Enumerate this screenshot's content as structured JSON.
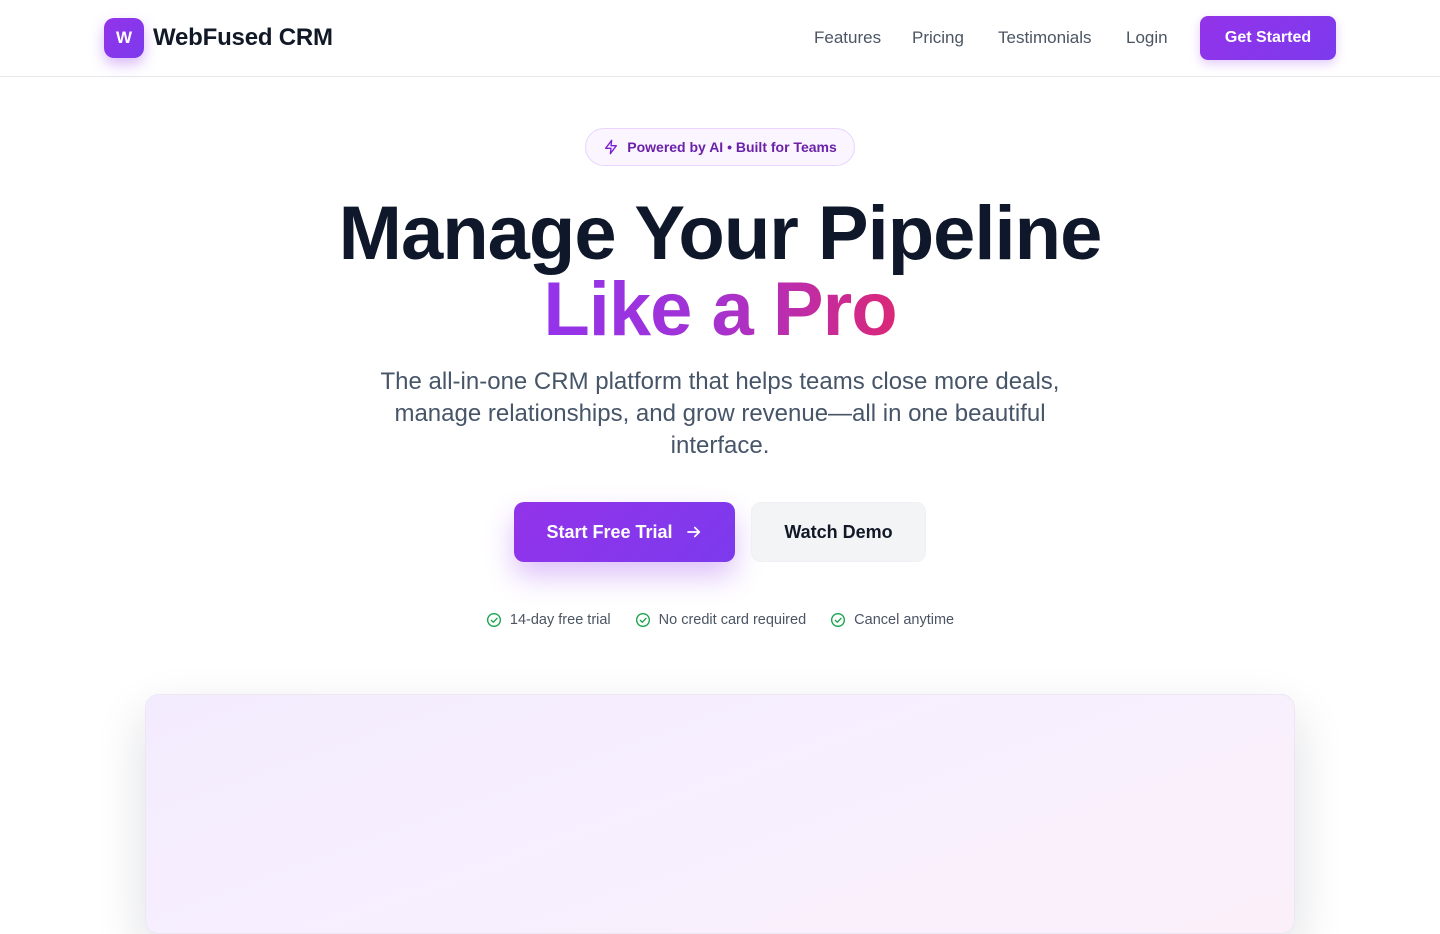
{
  "header": {
    "logo_letter": "W",
    "brand_name": "WebFused CRM",
    "nav": [
      "Features",
      "Pricing",
      "Testimonials",
      "Login"
    ],
    "cta_label": "Get Started"
  },
  "hero": {
    "badge_text": "Powered by AI • Built for Teams",
    "headline": "Manage Your Pipeline",
    "headline_accent": "Like a Pro",
    "subtitle_lines": [
      "The all-in-one CRM platform that helps teams close more deals,",
      "manage relationships, and grow revenue—all in one beautiful",
      "interface."
    ],
    "primary_cta": "Start Free Trial",
    "secondary_cta": "Watch Demo",
    "perks": [
      "14-day free trial",
      "No credit card required",
      "Cancel anytime"
    ]
  },
  "colors": {
    "primary": "#9333ea",
    "primary_dark": "#7c3aed",
    "accent_pink": "#db2777",
    "check_green": "#16a34a"
  },
  "icons": {
    "badge": "lightning-icon",
    "primary_cta": "arrow-right-icon",
    "perk": "check-circle-icon"
  }
}
